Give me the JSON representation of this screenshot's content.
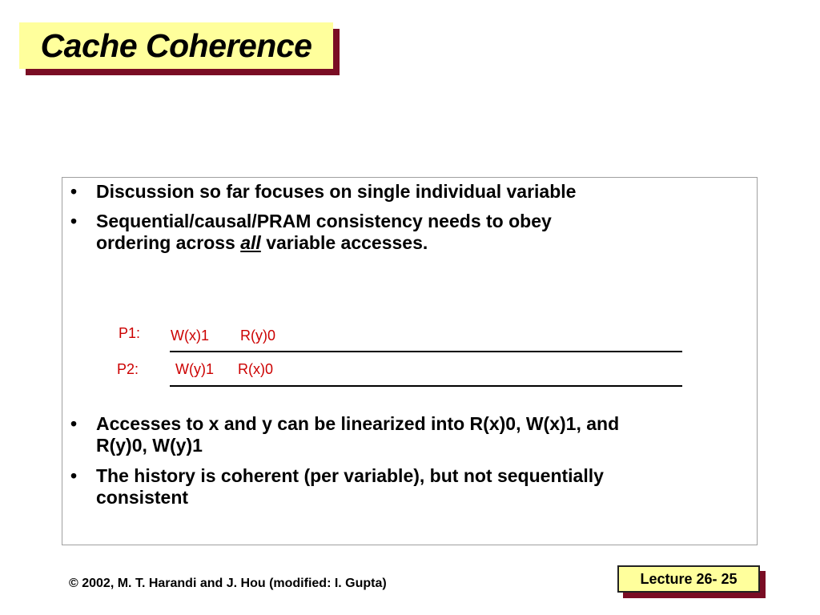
{
  "title": "Cache Coherence",
  "bullets_top": [
    {
      "lines": [
        "Discussion so far focuses on single individual variable"
      ]
    },
    {
      "line1": "Sequential/causal/PRAM consistency needs to obey",
      "line2_pre": "ordering across ",
      "line2_emph": "all",
      "line2_post": " variable accesses."
    }
  ],
  "timeline": {
    "p1_label": "P1:",
    "p1_op1": "W(x)1",
    "p1_op2": "R(y)0",
    "p2_label": "P2:",
    "p2_op1": "W(y)1",
    "p2_op2": "R(x)0"
  },
  "bullets_bottom": [
    {
      "line1": "Accesses to x and y can be linearized into R(x)0, W(x)1, and",
      "line2": "R(y)0, W(y)1"
    },
    {
      "line1": "The history is coherent (per variable), but not sequentially",
      "line2": "consistent"
    }
  ],
  "footer": "© 2002, M. T. Harandi and J. Hou (modified: I. Gupta)",
  "lecture_label": "Lecture 26- 25",
  "bullet_char": "•",
  "colors": {
    "title_bg": "#ffff9c",
    "shadow": "#7a0d24",
    "timeline_text": "#cc0000"
  }
}
